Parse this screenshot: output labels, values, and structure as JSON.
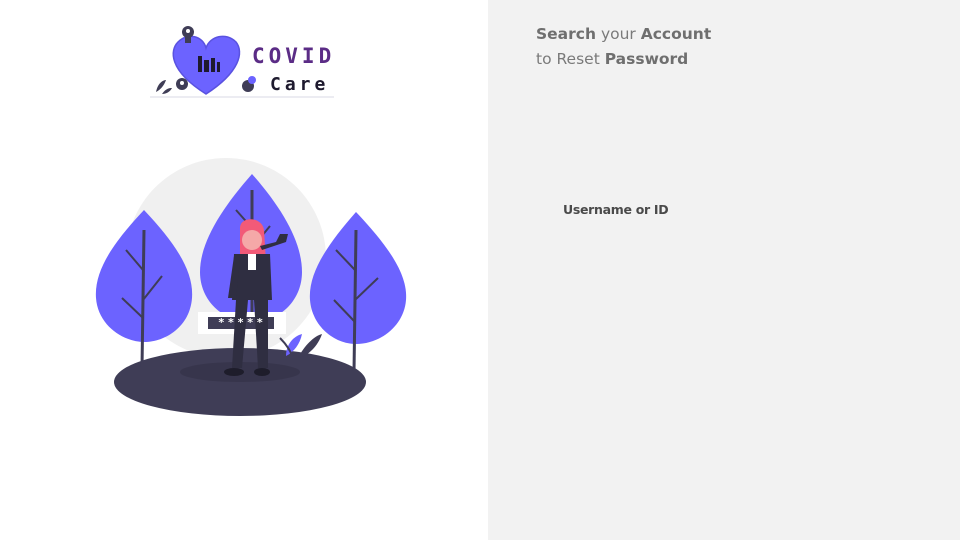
{
  "logo": {
    "word_top": "COVID",
    "word_bottom": "Care"
  },
  "illustration": {
    "password_mask": "*****"
  },
  "reset_form": {
    "heading_word_1": "Search",
    "heading_word_2": " your ",
    "heading_word_3": "Account",
    "heading_line2_word_1": "to Reset ",
    "heading_line2_word_2": "Password",
    "username_label": "Username or ID"
  },
  "colors": {
    "accent_purple": "#6c63ff",
    "dark_ground": "#3f3d56",
    "right_panel_bg": "#f2f2f2"
  }
}
